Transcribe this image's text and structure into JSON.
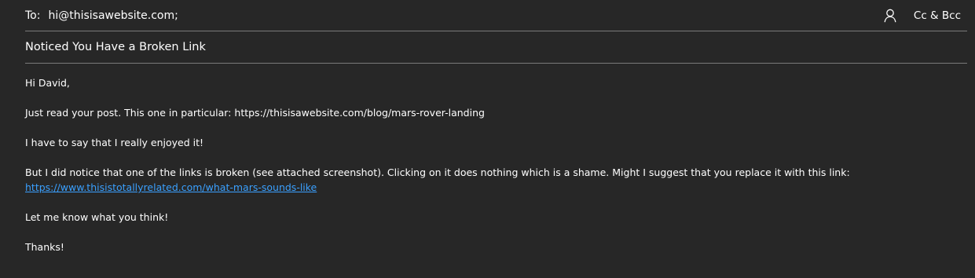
{
  "to_row": {
    "label": "To:",
    "value": "hi@thisisawebsite.com;",
    "cc_bcc_label": "Cc & Bcc",
    "person_icon": "person-icon"
  },
  "subject": "Noticed You Have a Broken Link",
  "body": {
    "greeting": "Hi David,",
    "line1": "Just read your post. This one in particular: https://thisisawebsite.com/blog/mars-rover-landing",
    "line2": "I have to say that I really enjoyed it!",
    "line3": "But I did notice that one of the links is broken (see attached screenshot). Clicking on it does nothing which is a shame. Might I suggest that you replace it with this link:",
    "link": "https://www.thisistotallyrelated.com/what-mars-sounds-like",
    "line4": "Let me know what you think!",
    "signoff": "Thanks!"
  },
  "colors": {
    "background": "#272727",
    "divider": "#7a7a7a",
    "link": "#3aa0ff",
    "text": "#ffffff"
  }
}
